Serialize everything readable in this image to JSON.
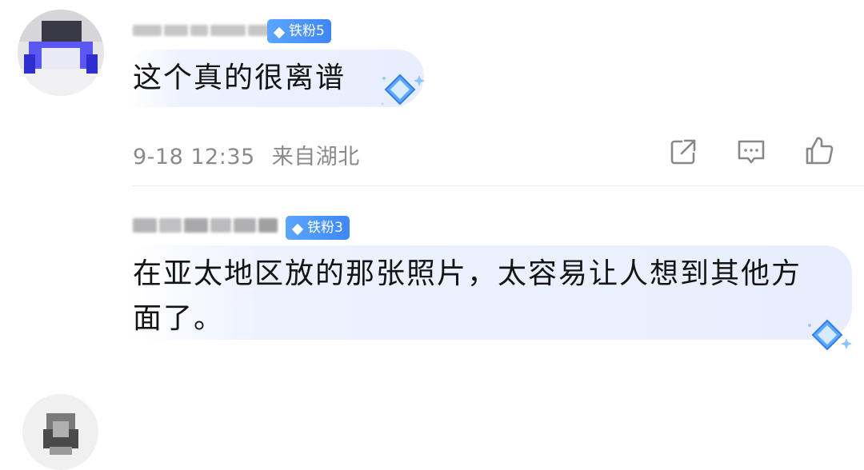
{
  "comments": [
    {
      "fan_badge": "铁粉5",
      "text": "这个真的很离谱",
      "time": "9-18 12:35",
      "location": "来自湖北",
      "actions": [
        "share-icon",
        "reply-icon",
        "like-icon"
      ]
    },
    {
      "fan_badge": "铁粉3",
      "text_line1": "在亚太地区放的那张照片，太容易让人想到其他方",
      "text_line2": "面了。"
    }
  ],
  "colors": {
    "badge_blue": "#4a92fa",
    "bubble_bg": "#e8eefe",
    "meta_gray": "#8a8a8a",
    "icon_gray": "#888888"
  }
}
